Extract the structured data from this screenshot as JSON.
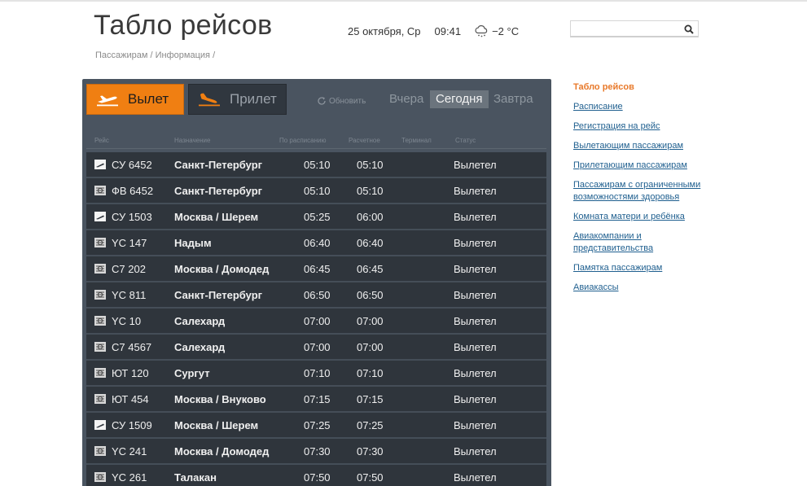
{
  "header": {
    "title": "Табло рейсов",
    "breadcrumb": [
      "Пассажирам",
      "Информация"
    ],
    "breadcrumb_sep": "/",
    "date": "25 октября, Ср",
    "time": "09:41",
    "weather_icon": "snow-cloud-icon",
    "temperature": "−2 °C",
    "search": {
      "value": "",
      "placeholder": ""
    }
  },
  "board": {
    "departure_label": "Вылет",
    "arrival_label": "Прилет",
    "active_direction": "departure",
    "refresh_label": "Обновить",
    "days": [
      "Вчера",
      "Сегодня",
      "Завтра"
    ],
    "active_day": "Сегодня",
    "columns": [
      "Рейс",
      "Назначение",
      "По расписанию",
      "Расчетное",
      "Терминал",
      "Статус"
    ],
    "rows": [
      {
        "icon": "plane-airline-icon",
        "flight": "СУ 6452",
        "dest": "Санкт-Петербург",
        "sched": "05:10",
        "est": "05:10",
        "terminal": "",
        "status": "Вылетел"
      },
      {
        "icon": "airline-logo-icon",
        "flight": "ФВ 6452",
        "dest": "Санкт-Петербург",
        "sched": "05:10",
        "est": "05:10",
        "terminal": "",
        "status": "Вылетел"
      },
      {
        "icon": "plane-airline-icon",
        "flight": "СУ 1503",
        "dest": "Москва / Шерем",
        "sched": "05:25",
        "est": "06:00",
        "terminal": "",
        "status": "Вылетел"
      },
      {
        "icon": "airline-logo-icon",
        "flight": "YC 147",
        "dest": "Надым",
        "sched": "06:40",
        "est": "06:40",
        "terminal": "",
        "status": "Вылетел"
      },
      {
        "icon": "airline-logo-icon",
        "flight": "С7 202",
        "dest": "Москва / Домодед",
        "sched": "06:45",
        "est": "06:45",
        "terminal": "",
        "status": "Вылетел"
      },
      {
        "icon": "airline-logo-icon",
        "flight": "YC 811",
        "dest": "Санкт-Петербург",
        "sched": "06:50",
        "est": "06:50",
        "terminal": "",
        "status": "Вылетел"
      },
      {
        "icon": "airline-logo-icon",
        "flight": "YC 10",
        "dest": "Салехард",
        "sched": "07:00",
        "est": "07:00",
        "terminal": "",
        "status": "Вылетел"
      },
      {
        "icon": "airline-logo-icon",
        "flight": "С7 4567",
        "dest": "Салехард",
        "sched": "07:00",
        "est": "07:00",
        "terminal": "",
        "status": "Вылетел"
      },
      {
        "icon": "airline-logo-icon",
        "flight": "ЮТ 120",
        "dest": "Сургут",
        "sched": "07:10",
        "est": "07:10",
        "terminal": "",
        "status": "Вылетел"
      },
      {
        "icon": "airline-logo-icon",
        "flight": "ЮТ 454",
        "dest": "Москва / Внуково",
        "sched": "07:15",
        "est": "07:15",
        "terminal": "",
        "status": "Вылетел"
      },
      {
        "icon": "plane-airline-icon",
        "flight": "СУ 1509",
        "dest": "Москва / Шерем",
        "sched": "07:25",
        "est": "07:25",
        "terminal": "",
        "status": "Вылетел"
      },
      {
        "icon": "airline-logo-icon",
        "flight": "YC 241",
        "dest": "Москва / Домодед",
        "sched": "07:30",
        "est": "07:30",
        "terminal": "",
        "status": "Вылетел"
      },
      {
        "icon": "airline-logo-icon",
        "flight": "YC 261",
        "dest": "Талакан",
        "sched": "07:50",
        "est": "07:50",
        "terminal": "",
        "status": "Вылетел"
      }
    ]
  },
  "sidebar": {
    "items": [
      {
        "label": "Табло рейсов",
        "active": true
      },
      {
        "label": "Расписание",
        "active": false
      },
      {
        "label": "Регистрация на рейс",
        "active": false
      },
      {
        "label": "Вылетающим пассажирам",
        "active": false
      },
      {
        "label": "Прилетающим пассажирам",
        "active": false
      },
      {
        "label": "Пассажирам с ограниченными возможностями здоровья",
        "active": false
      },
      {
        "label": "Комната матери и ребёнка",
        "active": false
      },
      {
        "label": "Авиакомпании и представительства",
        "active": false
      },
      {
        "label": "Памятка пассажирам",
        "active": false
      },
      {
        "label": "Авиакассы",
        "active": false
      }
    ]
  },
  "colors": {
    "accent": "#f07f12",
    "board_bg": "#4a5460",
    "row_bg": "#2f353c",
    "link": "#1f5f8f",
    "active_link": "#e8792a"
  }
}
